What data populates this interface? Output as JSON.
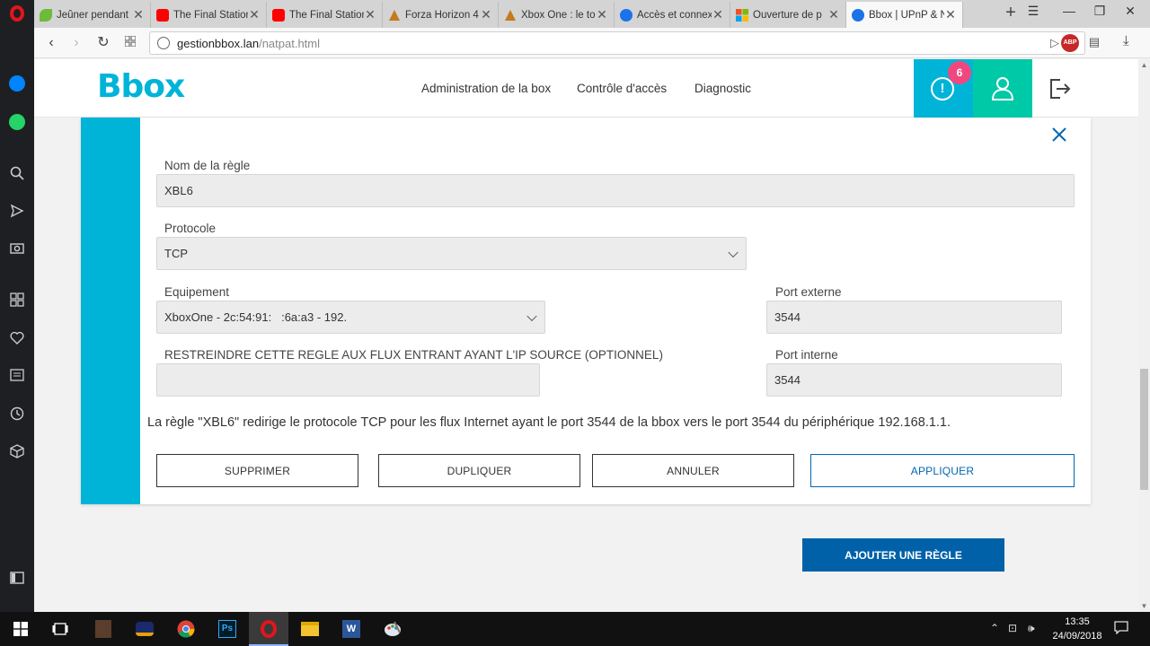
{
  "browser": {
    "tabs": [
      {
        "title": "Jeûner pendant",
        "favicon_color": "#6dbb3b"
      },
      {
        "title": "The Final Station",
        "favicon_color": "#ff0000"
      },
      {
        "title": "The Final Station",
        "favicon_color": "#ff0000"
      },
      {
        "title": "Forza Horizon 4",
        "favicon_color": "#c47a1d"
      },
      {
        "title": "Xbox One : le to",
        "favicon_color": "#c47a1d"
      },
      {
        "title": "Accès et connex",
        "favicon_color": "#1a73e8"
      },
      {
        "title": "Ouverture de p",
        "favicon_color": "#f25022"
      },
      {
        "title": "Bbox | UPnP & N",
        "favicon_color": "#1a73e8",
        "active": true
      }
    ],
    "url_host": "gestionbbox.lan",
    "url_path": "/natpat.html",
    "abp_label": "ABP"
  },
  "header": {
    "logo": "Bbox",
    "nav": [
      "Administration de la box",
      "Contrôle d'accès",
      "Diagnostic"
    ],
    "alert_icon": "!",
    "alert_count": "6"
  },
  "rule": {
    "name_label": "Nom de la règle",
    "name_value": "XBL6",
    "protocol_label": "Protocole",
    "protocol_value": "TCP",
    "device_label": "Equipement",
    "device_value": "XboxOne - 2c:54:91:   :6a:a3 - 192.      ",
    "restrict_label": "RESTREINDRE CETTE REGLE AUX FLUX ENTRANT AYANT L'IP SOURCE (OPTIONNEL)",
    "restrict_value": "",
    "ext_port_label": "Port externe",
    "ext_port_value": "3544",
    "int_port_label": "Port interne",
    "int_port_value": "3544",
    "summary": "La règle \"XBL6\" redirige le protocole TCP pour les flux Internet ayant le port 3544 de la bbox vers le port 3544 du périphérique 192.168.1.1.",
    "buttons": {
      "delete": "SUPPRIMER",
      "duplicate": "DUPLIQUER",
      "cancel": "ANNULER",
      "apply": "APPLIQUER"
    }
  },
  "add_rule_label": "AJOUTER UNE RÈGLE",
  "taskbar": {
    "time": "13:35",
    "date": "24/09/2018",
    "app_labels": {
      "photoshop": "Ps",
      "word": "W"
    }
  },
  "colors": {
    "brand_blue": "#00b4d8",
    "brand_green": "#00c9a7",
    "badge_pink": "#f0487e",
    "primary_button": "#0061a8"
  }
}
